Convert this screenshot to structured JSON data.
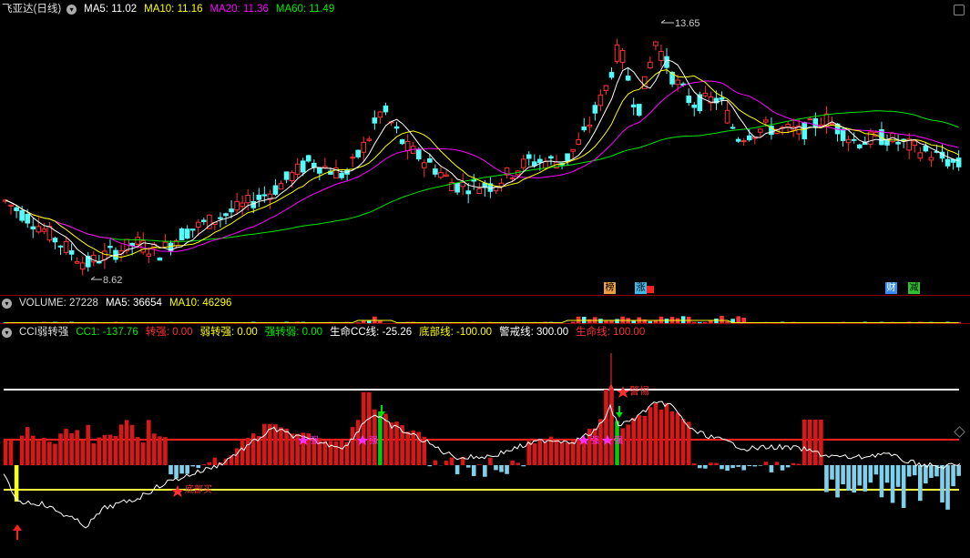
{
  "kline": {
    "title": "飞亚达(日线)",
    "ma5": "MA5: 11.02",
    "ma10": "MA10: 11.16",
    "ma20": "MA20: 11.36",
    "ma60": "MA60: 11.49",
    "high_label": "13.65",
    "low_label": "8.62",
    "event_tags": [
      "榜",
      "涨",
      "财",
      "减"
    ]
  },
  "volume": {
    "title": "VOLUME: 27228",
    "ma5": "MA5: 36654",
    "ma10": "MA10: 46296"
  },
  "cci": {
    "title": "CCI弱转强",
    "cc1": "CC1: -137.76",
    "zhuanqiang": "转强: 0.00",
    "ruozhuanqiang": "弱转强: 0.00",
    "qiangzhuanruo": "强转弱: 0.00",
    "shengming_cc": "生命CC线: -25.26",
    "dibu": "底部线: -100.00",
    "jingjie": "警戒线: 300.00",
    "shengming": "生命线: 100.00",
    "marker_bottom": "底部买",
    "marker_warn": "警惕",
    "marker_strong": "强"
  },
  "colors": {
    "up": "#ff3232",
    "down": "#54fcfc",
    "ma5": "#ffffff",
    "ma10": "#ffff00",
    "ma20": "#ff00ff",
    "ma60": "#00e600",
    "divider": "#8b0000"
  },
  "icons": {
    "collapse": "chevron-down-icon",
    "maximize": "square-icon",
    "settings": "diamond-icon"
  }
}
